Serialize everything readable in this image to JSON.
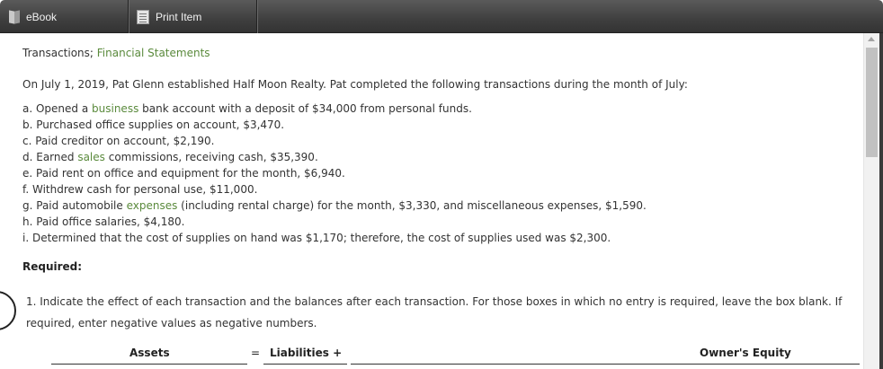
{
  "toolbar": {
    "ebook_label": "eBook",
    "print_label": "Print Item",
    "ebook_icon": "book-icon",
    "print_icon": "document-icon"
  },
  "content": {
    "heading_part1": "Transactions; ",
    "heading_part2": "Financial Statements",
    "intro": "On July 1, 2019, Pat Glenn established Half Moon Realty. Pat completed the following transactions during the month of July:",
    "transactions": [
      {
        "pre": "a. Opened a ",
        "link": "business",
        "post": " bank account with a deposit of $34,000 from personal funds."
      },
      {
        "pre": "b. Purchased office supplies on account, $3,470.",
        "link": "",
        "post": ""
      },
      {
        "pre": "c. Paid creditor on account, $2,190.",
        "link": "",
        "post": ""
      },
      {
        "pre": "d. Earned ",
        "link": "sales",
        "post": " commissions, receiving cash, $35,390."
      },
      {
        "pre": "e. Paid rent on office and equipment for the month, $6,940.",
        "link": "",
        "post": ""
      },
      {
        "pre": "f. Withdrew cash for personal use, $11,000.",
        "link": "",
        "post": ""
      },
      {
        "pre": "g. Paid automobile ",
        "link": "expenses",
        "post": " (including rental charge) for the month, $3,330, and miscellaneous expenses, $1,590."
      },
      {
        "pre": "h. Paid office salaries, $4,180.",
        "link": "",
        "post": ""
      },
      {
        "pre": "i. Determined that the cost of supplies on hand was $1,170; therefore, the cost of supplies used was $2,300.",
        "link": "",
        "post": ""
      }
    ],
    "required": "Required:",
    "q1_line1": "1. Indicate the effect of each transaction and the balances after each transaction. For those boxes in which no entry is required, leave the box blank. If",
    "q1_line2": "required, enter negative values as negative numbers.",
    "table_headers": {
      "assets": "Assets",
      "equals": "=",
      "liabilities": "Liabilities +",
      "owners_equity": "Owner's Equity"
    }
  },
  "colors": {
    "link_green": "#5a8a3c",
    "toolbar_dark": "#3f3f3f"
  }
}
